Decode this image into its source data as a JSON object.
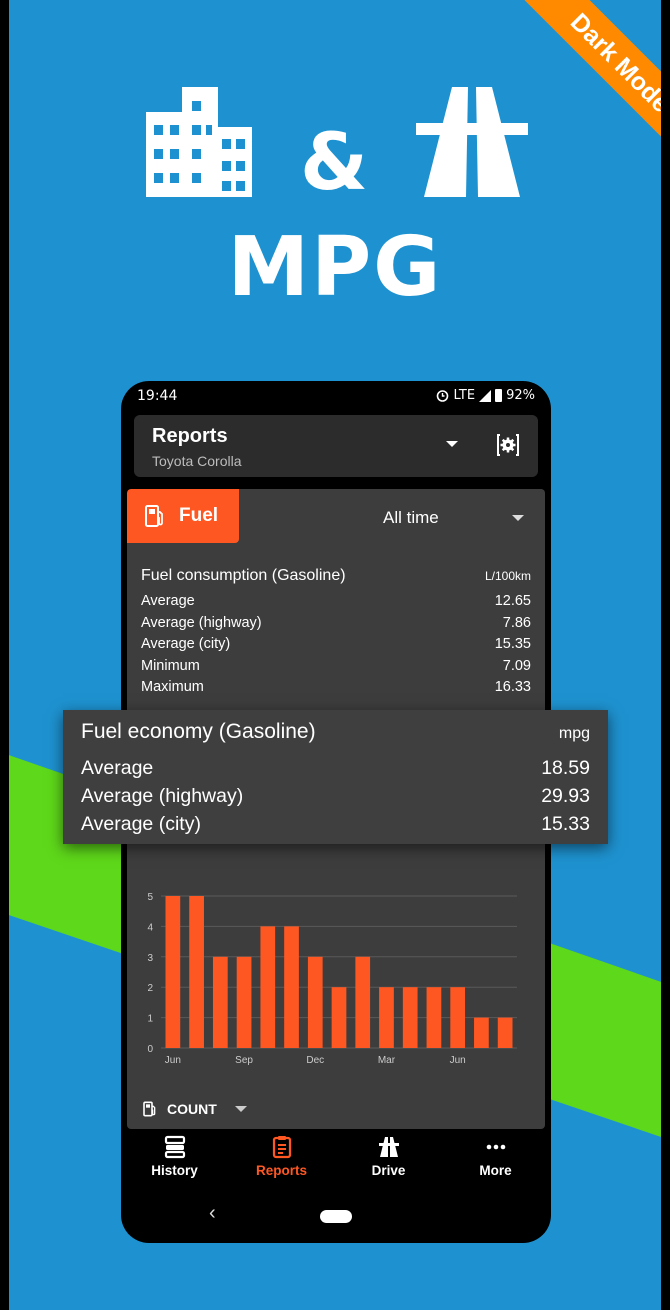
{
  "promo": {
    "title": "MPG",
    "ampersand": "&",
    "ribbon": "Dark Mode",
    "icons": [
      "city-buildings-icon",
      "highway-icon"
    ]
  },
  "colors": {
    "background": "#1E92D0",
    "ribbon": "#FF8A00",
    "accent": "#FF5722",
    "stripe": "#5ED81A",
    "card": "#3D3D3D"
  },
  "status_bar": {
    "time": "19:44",
    "network": "LTE",
    "battery": "92%",
    "icons": [
      "alarm-icon",
      "signal-icon",
      "battery-icon"
    ]
  },
  "app_bar": {
    "title": "Reports",
    "subtitle": "Toyota Corolla",
    "icons": [
      "dropdown-arrow-icon",
      "report-settings-icon"
    ]
  },
  "report": {
    "tab_label": "Fuel",
    "period": "All time",
    "consumption": {
      "title": "Fuel consumption (Gasoline)",
      "unit": "L/100km",
      "rows": [
        {
          "label": "Average",
          "value": "12.65"
        },
        {
          "label": "Average (highway)",
          "value": "7.86"
        },
        {
          "label": "Average (city)",
          "value": "15.35"
        },
        {
          "label": "Minimum",
          "value": "7.09"
        },
        {
          "label": "Maximum",
          "value": "16.33"
        }
      ]
    },
    "economy_popup": {
      "title": "Fuel economy (Gasoline)",
      "unit": "mpg",
      "rows": [
        {
          "label": "Average",
          "value": "18.59"
        },
        {
          "label": "Average (highway)",
          "value": "29.93"
        },
        {
          "label": "Average (city)",
          "value": "15.33"
        }
      ]
    },
    "count_selector": "COUNT"
  },
  "chart_data": {
    "type": "bar",
    "categories": [
      "Jun",
      "Jul",
      "Aug",
      "Sep",
      "Oct",
      "Nov",
      "Dec",
      "Jan",
      "Feb",
      "Mar",
      "Apr",
      "May",
      "Jun",
      "Jul",
      "Aug"
    ],
    "x_tick_labels": [
      "Jun",
      "",
      "",
      "Sep",
      "",
      "",
      "Dec",
      "",
      "",
      "Mar",
      "",
      "",
      "Jun",
      "",
      ""
    ],
    "values": [
      5,
      5,
      3,
      3,
      4,
      4,
      3,
      2,
      3,
      2,
      2,
      2,
      2,
      1,
      1
    ],
    "y_ticks": [
      0,
      1,
      2,
      3,
      4,
      5
    ],
    "ylim": [
      0,
      5
    ],
    "title": "",
    "xlabel": "",
    "ylabel": "",
    "grid": true,
    "bar_color": "#FF5722"
  },
  "bottom_nav": [
    {
      "label": "History",
      "icon": "history-icon",
      "active": false
    },
    {
      "label": "Reports",
      "icon": "reports-icon",
      "active": true
    },
    {
      "label": "Drive",
      "icon": "drive-road-icon",
      "active": false
    },
    {
      "label": "More",
      "icon": "more-dots-icon",
      "active": false
    }
  ],
  "system_nav": {
    "back": "‹"
  }
}
